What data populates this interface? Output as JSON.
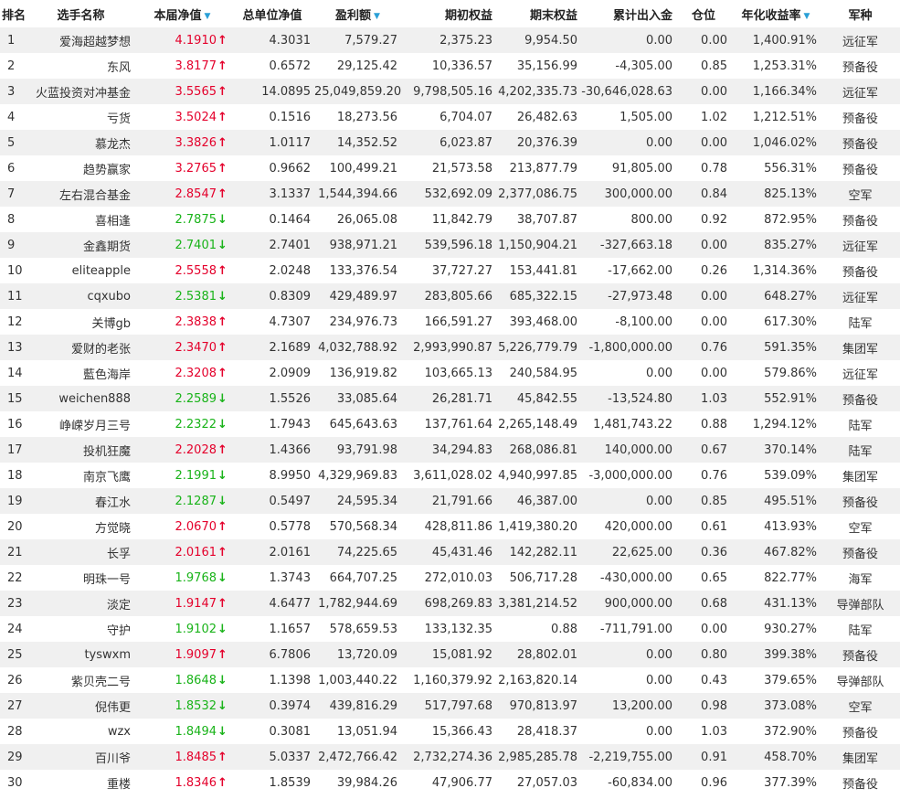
{
  "headers": {
    "rank": "排名",
    "name": "选手名称",
    "nav": "本届净值",
    "total_nav": "总单位净值",
    "profit": "盈利额",
    "start_equity": "期初权益",
    "end_equity": "期末权益",
    "net_flow": "累计出入金",
    "position": "仓位",
    "annual_return": "年化收益率",
    "army": "军种"
  },
  "sort_indicator_icon": "sort-down-triangle-icon",
  "colors": {
    "up": "#e4002b",
    "down": "#19b319",
    "sort": "#2a9fd6",
    "stripe": "#f0f0f0"
  },
  "rows": [
    {
      "rank": "1",
      "name": "爱海超越梦想",
      "nav": "4.1910",
      "dir": "up",
      "total_nav": "4.3031",
      "profit": "7,579.27",
      "start_equity": "2,375.23",
      "end_equity": "9,954.50",
      "net_flow": "0.00",
      "position": "0.00",
      "annual_return": "1,400.91%",
      "army": "远征军"
    },
    {
      "rank": "2",
      "name": "东风",
      "nav": "3.8177",
      "dir": "up",
      "total_nav": "0.6572",
      "profit": "29,125.42",
      "start_equity": "10,336.57",
      "end_equity": "35,156.99",
      "net_flow": "-4,305.00",
      "position": "0.85",
      "annual_return": "1,253.31%",
      "army": "预备役"
    },
    {
      "rank": "3",
      "name": "火蓝投资对冲基金",
      "nav": "3.5565",
      "dir": "up",
      "total_nav": "14.0895",
      "profit": "25,049,859.20",
      "start_equity": "9,798,505.16",
      "end_equity": "4,202,335.73",
      "net_flow": "-30,646,028.63",
      "position": "0.00",
      "annual_return": "1,166.34%",
      "army": "远征军"
    },
    {
      "rank": "4",
      "name": "亏货",
      "nav": "3.5024",
      "dir": "up",
      "total_nav": "0.1516",
      "profit": "18,273.56",
      "start_equity": "6,704.07",
      "end_equity": "26,482.63",
      "net_flow": "1,505.00",
      "position": "1.02",
      "annual_return": "1,212.51%",
      "army": "预备役"
    },
    {
      "rank": "5",
      "name": "慕龙杰",
      "nav": "3.3826",
      "dir": "up",
      "total_nav": "1.0117",
      "profit": "14,352.52",
      "start_equity": "6,023.87",
      "end_equity": "20,376.39",
      "net_flow": "0.00",
      "position": "0.00",
      "annual_return": "1,046.02%",
      "army": "预备役"
    },
    {
      "rank": "6",
      "name": "趋势赢家",
      "nav": "3.2765",
      "dir": "up",
      "total_nav": "0.9662",
      "profit": "100,499.21",
      "start_equity": "21,573.58",
      "end_equity": "213,877.79",
      "net_flow": "91,805.00",
      "position": "0.78",
      "annual_return": "556.31%",
      "army": "预备役"
    },
    {
      "rank": "7",
      "name": "左右混合基金",
      "nav": "2.8547",
      "dir": "up",
      "total_nav": "3.1337",
      "profit": "1,544,394.66",
      "start_equity": "532,692.09",
      "end_equity": "2,377,086.75",
      "net_flow": "300,000.00",
      "position": "0.84",
      "annual_return": "825.13%",
      "army": "空军"
    },
    {
      "rank": "8",
      "name": "喜相逢",
      "nav": "2.7875",
      "dir": "down",
      "total_nav": "0.1464",
      "profit": "26,065.08",
      "start_equity": "11,842.79",
      "end_equity": "38,707.87",
      "net_flow": "800.00",
      "position": "0.92",
      "annual_return": "872.95%",
      "army": "预备役"
    },
    {
      "rank": "9",
      "name": "金鑫期货",
      "nav": "2.7401",
      "dir": "down",
      "total_nav": "2.7401",
      "profit": "938,971.21",
      "start_equity": "539,596.18",
      "end_equity": "1,150,904.21",
      "net_flow": "-327,663.18",
      "position": "0.00",
      "annual_return": "835.27%",
      "army": "远征军"
    },
    {
      "rank": "10",
      "name": "eliteapple",
      "nav": "2.5558",
      "dir": "up",
      "total_nav": "2.0248",
      "profit": "133,376.54",
      "start_equity": "37,727.27",
      "end_equity": "153,441.81",
      "net_flow": "-17,662.00",
      "position": "0.26",
      "annual_return": "1,314.36%",
      "army": "预备役"
    },
    {
      "rank": "11",
      "name": "cqxubo",
      "nav": "2.5381",
      "dir": "down",
      "total_nav": "0.8309",
      "profit": "429,489.97",
      "start_equity": "283,805.66",
      "end_equity": "685,322.15",
      "net_flow": "-27,973.48",
      "position": "0.00",
      "annual_return": "648.27%",
      "army": "远征军"
    },
    {
      "rank": "12",
      "name": "关博gb",
      "nav": "2.3838",
      "dir": "up",
      "total_nav": "4.7307",
      "profit": "234,976.73",
      "start_equity": "166,591.27",
      "end_equity": "393,468.00",
      "net_flow": "-8,100.00",
      "position": "0.00",
      "annual_return": "617.30%",
      "army": "陆军"
    },
    {
      "rank": "13",
      "name": "爱财的老张",
      "nav": "2.3470",
      "dir": "up",
      "total_nav": "2.1689",
      "profit": "4,032,788.92",
      "start_equity": "2,993,990.87",
      "end_equity": "5,226,779.79",
      "net_flow": "-1,800,000.00",
      "position": "0.76",
      "annual_return": "591.35%",
      "army": "集团军"
    },
    {
      "rank": "14",
      "name": "藍色海岸",
      "nav": "2.3208",
      "dir": "up",
      "total_nav": "2.0909",
      "profit": "136,919.82",
      "start_equity": "103,665.13",
      "end_equity": "240,584.95",
      "net_flow": "0.00",
      "position": "0.00",
      "annual_return": "579.86%",
      "army": "远征军"
    },
    {
      "rank": "15",
      "name": "weichen888",
      "nav": "2.2589",
      "dir": "down",
      "total_nav": "1.5526",
      "profit": "33,085.64",
      "start_equity": "26,281.71",
      "end_equity": "45,842.55",
      "net_flow": "-13,524.80",
      "position": "1.03",
      "annual_return": "552.91%",
      "army": "预备役"
    },
    {
      "rank": "16",
      "name": "峥嵘岁月三号",
      "nav": "2.2322",
      "dir": "down",
      "total_nav": "1.7943",
      "profit": "645,643.63",
      "start_equity": "137,761.64",
      "end_equity": "2,265,148.49",
      "net_flow": "1,481,743.22",
      "position": "0.88",
      "annual_return": "1,294.12%",
      "army": "陆军"
    },
    {
      "rank": "17",
      "name": "投机狂魔",
      "nav": "2.2028",
      "dir": "up",
      "total_nav": "1.4366",
      "profit": "93,791.98",
      "start_equity": "34,294.83",
      "end_equity": "268,086.81",
      "net_flow": "140,000.00",
      "position": "0.67",
      "annual_return": "370.14%",
      "army": "陆军"
    },
    {
      "rank": "18",
      "name": "南京飞鹰",
      "nav": "2.1991",
      "dir": "down",
      "total_nav": "8.9950",
      "profit": "4,329,969.83",
      "start_equity": "3,611,028.02",
      "end_equity": "4,940,997.85",
      "net_flow": "-3,000,000.00",
      "position": "0.76",
      "annual_return": "539.09%",
      "army": "集团军"
    },
    {
      "rank": "19",
      "name": "春江水",
      "nav": "2.1287",
      "dir": "down",
      "total_nav": "0.5497",
      "profit": "24,595.34",
      "start_equity": "21,791.66",
      "end_equity": "46,387.00",
      "net_flow": "0.00",
      "position": "0.85",
      "annual_return": "495.51%",
      "army": "预备役"
    },
    {
      "rank": "20",
      "name": "方觉晓",
      "nav": "2.0670",
      "dir": "up",
      "total_nav": "0.5778",
      "profit": "570,568.34",
      "start_equity": "428,811.86",
      "end_equity": "1,419,380.20",
      "net_flow": "420,000.00",
      "position": "0.61",
      "annual_return": "413.93%",
      "army": "空军"
    },
    {
      "rank": "21",
      "name": "长孚",
      "nav": "2.0161",
      "dir": "up",
      "total_nav": "2.0161",
      "profit": "74,225.65",
      "start_equity": "45,431.46",
      "end_equity": "142,282.11",
      "net_flow": "22,625.00",
      "position": "0.36",
      "annual_return": "467.82%",
      "army": "预备役"
    },
    {
      "rank": "22",
      "name": "明珠一号",
      "nav": "1.9768",
      "dir": "down",
      "total_nav": "1.3743",
      "profit": "664,707.25",
      "start_equity": "272,010.03",
      "end_equity": "506,717.28",
      "net_flow": "-430,000.00",
      "position": "0.65",
      "annual_return": "822.77%",
      "army": "海军"
    },
    {
      "rank": "23",
      "name": "淡定",
      "nav": "1.9147",
      "dir": "up",
      "total_nav": "4.6477",
      "profit": "1,782,944.69",
      "start_equity": "698,269.83",
      "end_equity": "3,381,214.52",
      "net_flow": "900,000.00",
      "position": "0.68",
      "annual_return": "431.13%",
      "army": "导弹部队"
    },
    {
      "rank": "24",
      "name": "守护",
      "nav": "1.9102",
      "dir": "down",
      "total_nav": "1.1657",
      "profit": "578,659.53",
      "start_equity": "133,132.35",
      "end_equity": "0.88",
      "net_flow": "-711,791.00",
      "position": "0.00",
      "annual_return": "930.27%",
      "army": "陆军"
    },
    {
      "rank": "25",
      "name": "tyswxm",
      "nav": "1.9097",
      "dir": "up",
      "total_nav": "6.7806",
      "profit": "13,720.09",
      "start_equity": "15,081.92",
      "end_equity": "28,802.01",
      "net_flow": "0.00",
      "position": "0.80",
      "annual_return": "399.38%",
      "army": "预备役"
    },
    {
      "rank": "26",
      "name": "紫贝壳二号",
      "nav": "1.8648",
      "dir": "down",
      "total_nav": "1.1398",
      "profit": "1,003,440.22",
      "start_equity": "1,160,379.92",
      "end_equity": "2,163,820.14",
      "net_flow": "0.00",
      "position": "0.43",
      "annual_return": "379.65%",
      "army": "导弹部队"
    },
    {
      "rank": "27",
      "name": "倪伟更",
      "nav": "1.8532",
      "dir": "down",
      "total_nav": "0.3974",
      "profit": "439,816.29",
      "start_equity": "517,797.68",
      "end_equity": "970,813.97",
      "net_flow": "13,200.00",
      "position": "0.98",
      "annual_return": "373.08%",
      "army": "空军"
    },
    {
      "rank": "28",
      "name": "wzx",
      "nav": "1.8494",
      "dir": "down",
      "total_nav": "0.3081",
      "profit": "13,051.94",
      "start_equity": "15,366.43",
      "end_equity": "28,418.37",
      "net_flow": "0.00",
      "position": "1.03",
      "annual_return": "372.90%",
      "army": "预备役"
    },
    {
      "rank": "29",
      "name": "百川爷",
      "nav": "1.8485",
      "dir": "up",
      "total_nav": "5.0337",
      "profit": "2,472,766.42",
      "start_equity": "2,732,274.36",
      "end_equity": "2,985,285.78",
      "net_flow": "-2,219,755.00",
      "position": "0.91",
      "annual_return": "458.70%",
      "army": "集团军"
    },
    {
      "rank": "30",
      "name": "重楼",
      "nav": "1.8346",
      "dir": "up",
      "total_nav": "1.8539",
      "profit": "39,984.26",
      "start_equity": "47,906.77",
      "end_equity": "27,057.03",
      "net_flow": "-60,834.00",
      "position": "0.96",
      "annual_return": "377.39%",
      "army": "预备役"
    }
  ]
}
